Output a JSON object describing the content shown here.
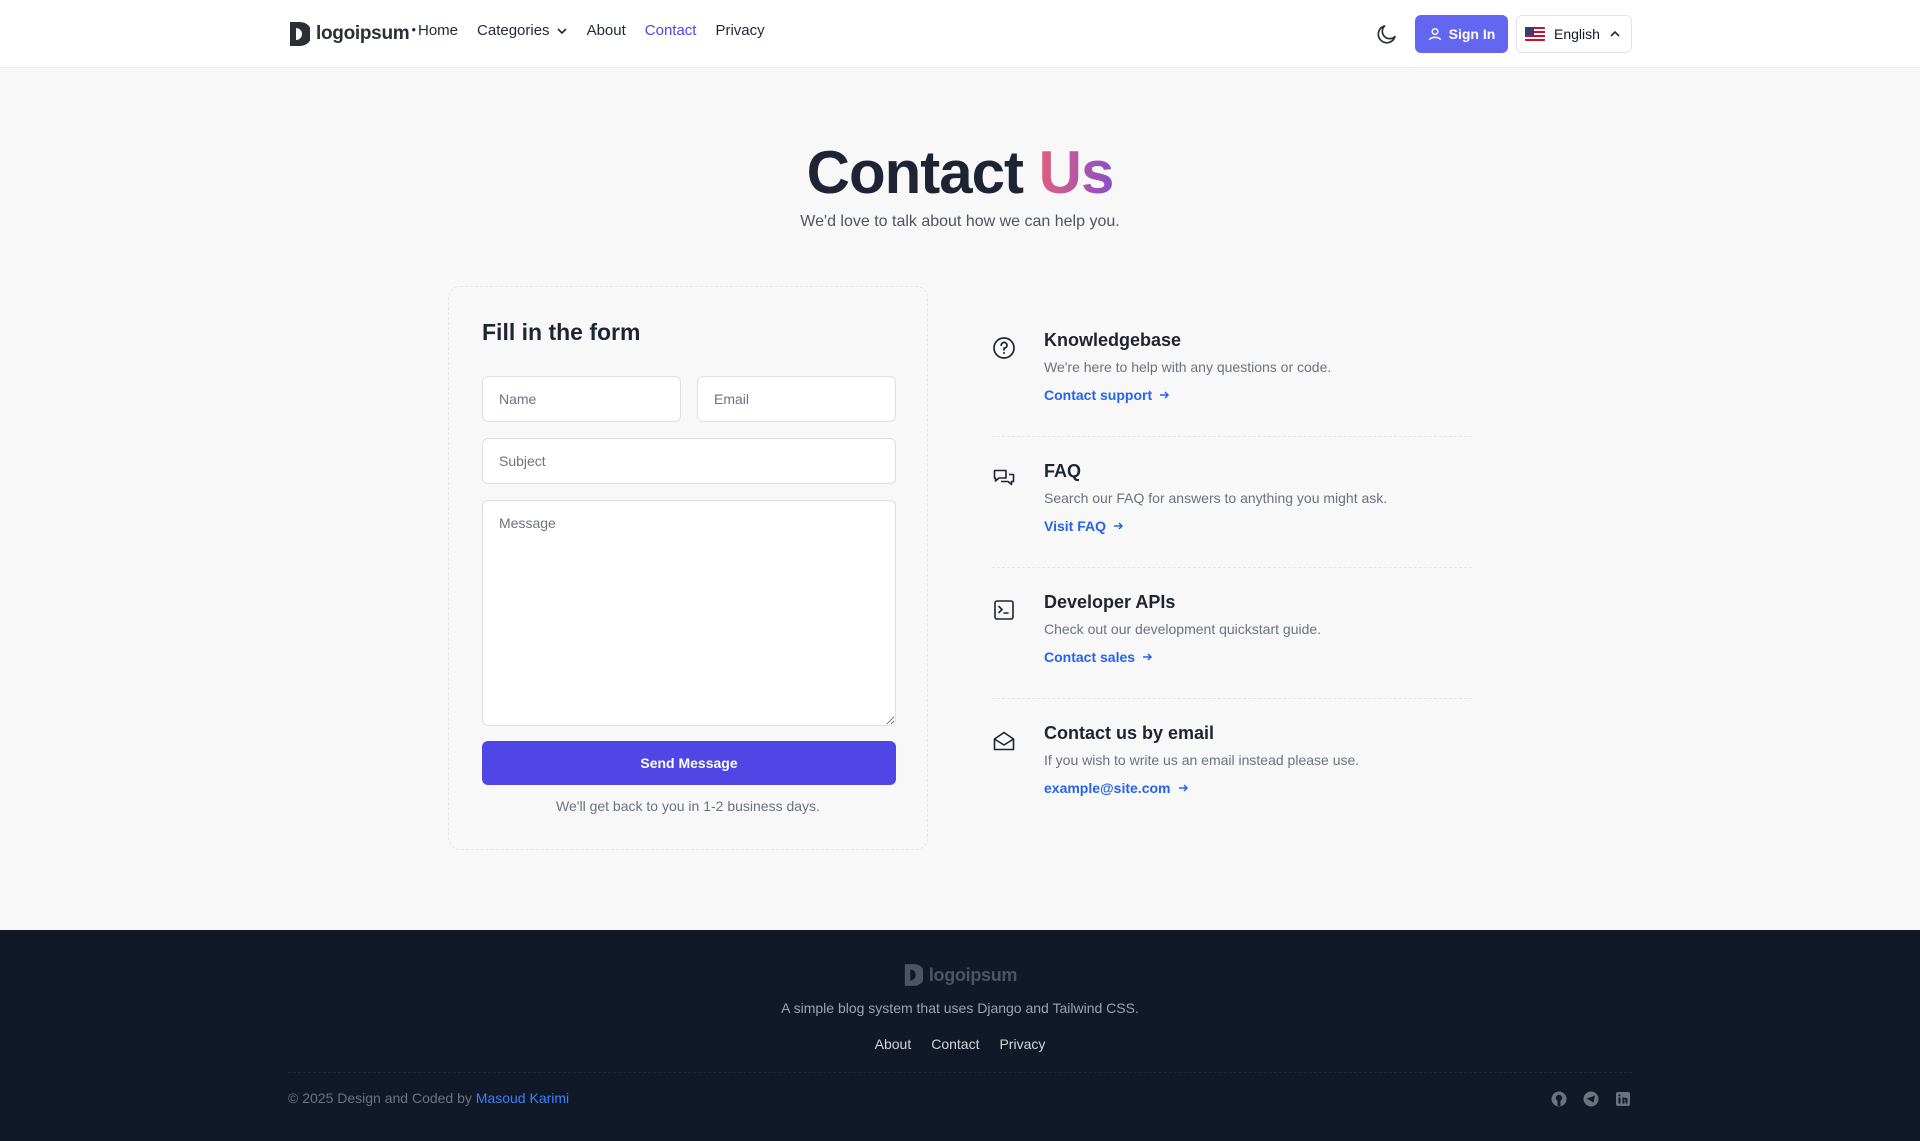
{
  "nav": {
    "logo_text": "logoipsum",
    "links": [
      "Home",
      "Categories",
      "About",
      "Contact",
      "Privacy"
    ],
    "signin_label": "Sign In",
    "language_label": "English"
  },
  "hero": {
    "title_main": "Contact",
    "title_accent": "Us",
    "subtitle": "We'd love to talk about how we can help you."
  },
  "form": {
    "title": "Fill in the form",
    "name_placeholder": "Name",
    "email_placeholder": "Email",
    "subject_placeholder": "Subject",
    "message_placeholder": "Message",
    "submit_label": "Send Message",
    "note": "We'll get back to you in 1-2 business days."
  },
  "info": [
    {
      "title": "Knowledgebase",
      "desc": "We're here to help with any questions or code.",
      "link": "Contact support",
      "icon": "question-circle-icon"
    },
    {
      "title": "FAQ",
      "desc": "Search our FAQ for answers to anything you might ask.",
      "link": "Visit FAQ",
      "icon": "chat-bubbles-icon"
    },
    {
      "title": "Developer APIs",
      "desc": "Check out our development quickstart guide.",
      "link": "Contact sales",
      "icon": "terminal-icon"
    },
    {
      "title": "Contact us by email",
      "desc": "If you wish to write us an email instead please use.",
      "link": "example@site.com",
      "icon": "envelope-open-icon"
    }
  ],
  "footer": {
    "logo_text": "logoipsum",
    "description": "A simple blog system that uses Django and Tailwind CSS.",
    "links": [
      "About",
      "Contact",
      "Privacy"
    ],
    "copyright_prefix": "© 2025 Design and Coded by",
    "author": "Masoud Karimi",
    "social": [
      "github-icon",
      "telegram-icon",
      "linkedin-icon"
    ]
  },
  "colors": {
    "accent": "#6366f1",
    "primary_button": "#4f46e5",
    "link": "#2563eb",
    "footer_bg": "#111827"
  }
}
